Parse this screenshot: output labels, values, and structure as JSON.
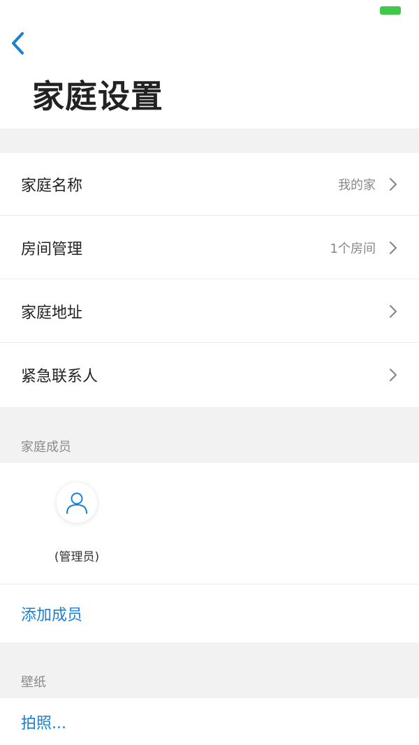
{
  "page_title": "家庭设置",
  "settings": [
    {
      "label": "家庭名称",
      "value": "我的家"
    },
    {
      "label": "房间管理",
      "value": "1个房间"
    },
    {
      "label": "家庭地址",
      "value": ""
    },
    {
      "label": "紧急联系人",
      "value": ""
    }
  ],
  "members_section": {
    "label": "家庭成员",
    "members": [
      {
        "name": "(管理员)"
      }
    ],
    "add_label": "添加成员"
  },
  "wallpaper_section": {
    "label": "壁纸",
    "take_photo_label": "拍照..."
  },
  "icons": {
    "back": "chevron-left-icon",
    "row_arrow": "chevron-right-icon",
    "avatar": "user-icon"
  },
  "colors": {
    "accent": "#1a7fd6",
    "battery": "#3ec94a",
    "section_bg": "#f2f2f2"
  }
}
